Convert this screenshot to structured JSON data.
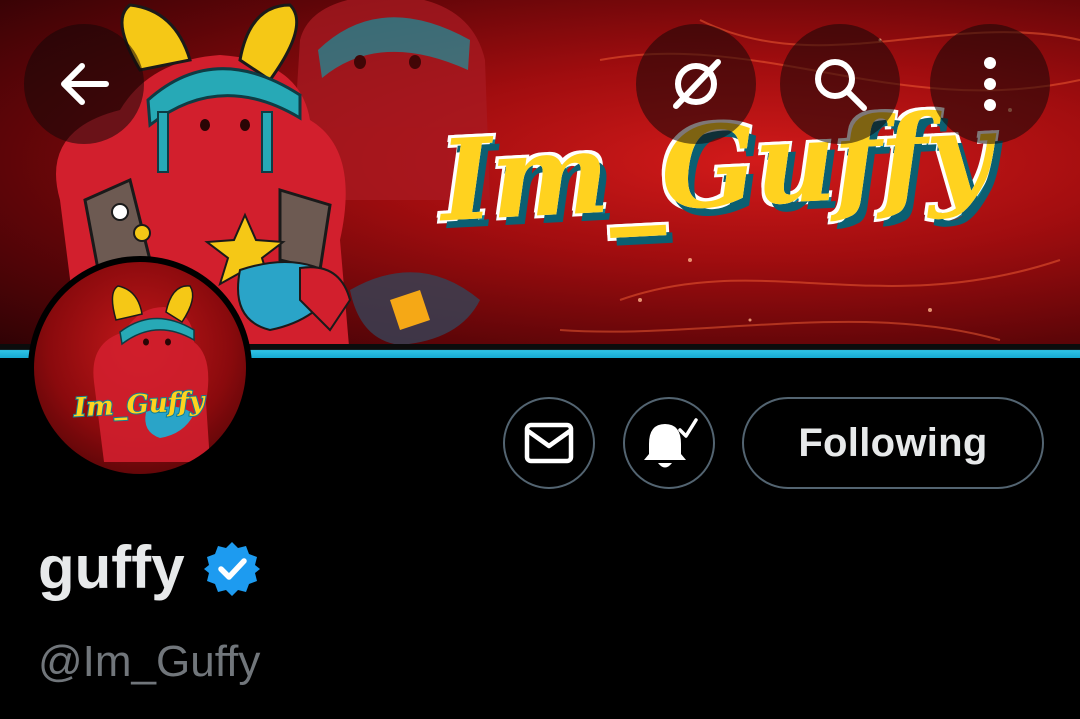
{
  "header": {
    "back_icon": "arrow-left-icon",
    "grok_icon": "grok-slash-circle-icon",
    "search_icon": "search-icon",
    "more_icon": "more-vertical-icon"
  },
  "banner": {
    "logo_text": "Im_Guffy",
    "accent_color": "#2fc3e6",
    "background_color": "#b3121a"
  },
  "avatar": {
    "logo_text": "Im_Guffy"
  },
  "actions": {
    "message_icon": "envelope-icon",
    "notify_icon": "bell-check-icon",
    "follow_label": "Following"
  },
  "profile": {
    "display_name": "guffy",
    "verified_icon": "verified-badge-icon",
    "verified_color": "#1d9bf0",
    "handle": "@Im_Guffy"
  }
}
